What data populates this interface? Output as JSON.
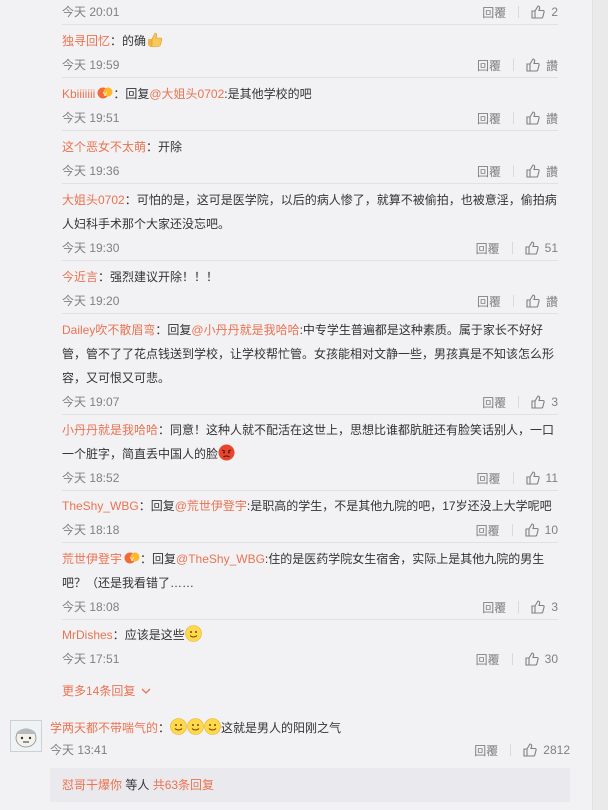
{
  "replies": [
    {
      "time": "今天 20:01",
      "reply_label": "回覆",
      "likes": "2"
    },
    {
      "user": "独寻回忆",
      "sep": "：",
      "text": "的确",
      "time": "今天 19:59",
      "reply_label": "回覆",
      "likes": "讚"
    },
    {
      "user": "Kbiiiiiii",
      "sep": "：",
      "pre": "回复",
      "mention": "@大姐头0702",
      "text": ":是其他学校的吧",
      "time": "今天 19:51",
      "reply_label": "回覆",
      "likes": "讚"
    },
    {
      "user": "这个恶女不太萌",
      "sep": "：",
      "text": "开除",
      "time": "今天 19:36",
      "reply_label": "回覆",
      "likes": "讚"
    },
    {
      "user": "大姐头0702",
      "sep": "：",
      "text": "可怕的是，这可是医学院，以后的病人惨了，就算不被偷拍，也被意淫，偷拍病",
      "text2": "人妇科手术那个大家还没忘吧。",
      "time": "今天 19:30",
      "reply_label": "回覆",
      "likes": "51"
    },
    {
      "user": "今近言",
      "sep": "：",
      "text": "强烈建议开除！！！",
      "time": "今天 19:20",
      "reply_label": "回覆",
      "likes": "讚"
    },
    {
      "user": "Dailey吹不散眉弯",
      "sep": "：",
      "pre": "回复",
      "mention": "@小丹丹就是我哈哈",
      "text": ":中专学生普遍都是这种素质。属于家长不好好",
      "text2": "管，管不了了花点钱送到学校，让学校帮忙管。女孩能相对文静一些，男孩真是不知该怎么形",
      "text3": "容，又可恨又可悲。",
      "time": "今天 19:07",
      "reply_label": "回覆",
      "likes": "3"
    },
    {
      "user": "小丹丹就是我哈哈",
      "sep": "：",
      "text": "同意！这种人就不配活在这世上，思想比谁都肮脏还有脸笑话别人，一口",
      "text2": "一个脏字，简直丢中国人的脸",
      "time": "今天 18:52",
      "reply_label": "回覆",
      "likes": "11"
    },
    {
      "user": "TheShy_WBG",
      "sep": "：",
      "pre": "回复",
      "mention": "@荒世伊登宇",
      "text": ":是职高的学生，不是其他九院的吧，17岁还没上大学呢吧",
      "time": "今天 18:18",
      "reply_label": "回覆",
      "likes": "10"
    },
    {
      "user": "荒世伊登宇",
      "sep": "：",
      "pre": "回复",
      "mention": "@TheShy_WBG",
      "text": ":住的是医药学院女生宿舍，实际上是其他九院的男生",
      "text2": "吧？（还是我看错了……",
      "time": "今天 18:08",
      "reply_label": "回覆",
      "likes": "3"
    },
    {
      "user": "MrDishes",
      "sep": "：",
      "text": "应该是这些",
      "time": "今天 17:51",
      "reply_label": "回覆",
      "likes": "30"
    }
  ],
  "more_replies": "更多14条回复",
  "main_comment": {
    "user": "学两天都不带喘气的",
    "sep": "：",
    "text": "这就是男人的阳刚之气",
    "time": "今天 13:41",
    "reply_label": "回覆",
    "likes": "2812"
  },
  "footer": {
    "user": "怼哥干爆你",
    "mid": " 等人 ",
    "total": "共63条回复"
  },
  "colors": {
    "accent": "#eb7350",
    "meta": "#808080",
    "panel": "#f2f2f5"
  }
}
